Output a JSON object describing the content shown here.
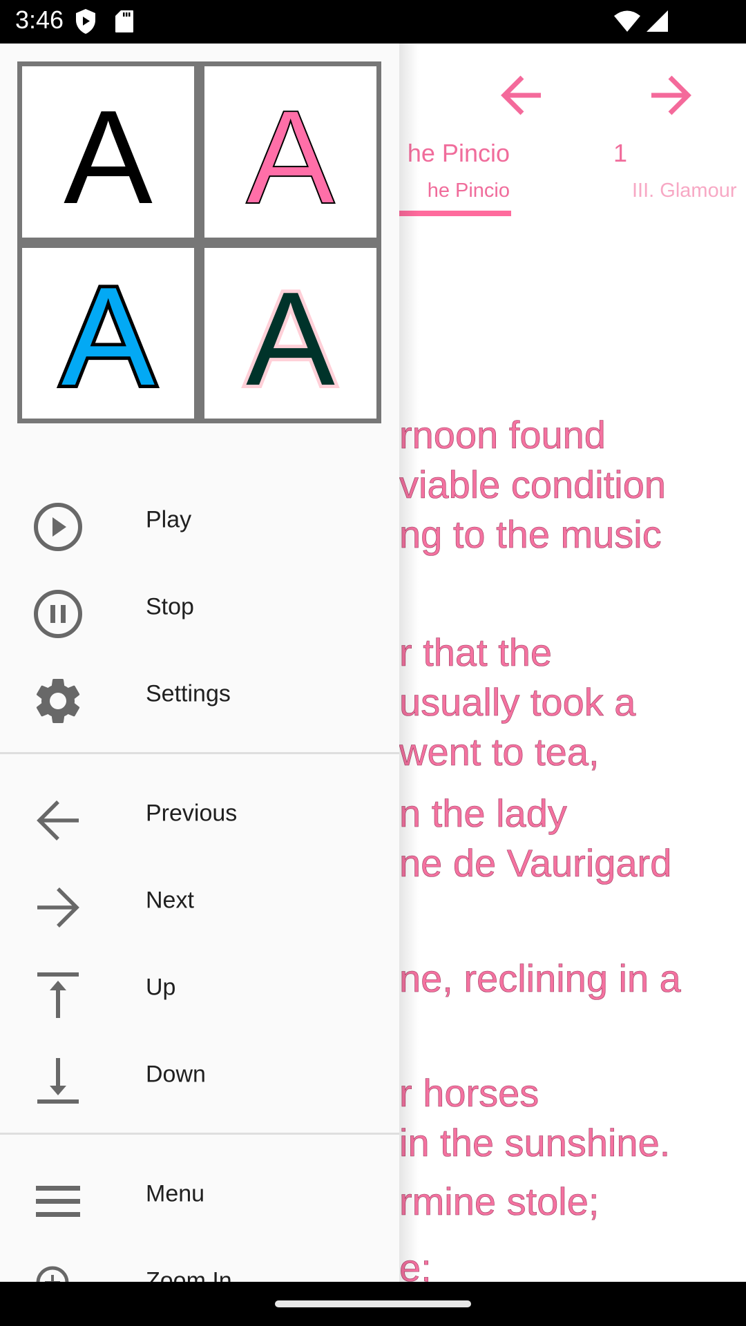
{
  "status_bar": {
    "time": "3:46",
    "icons": [
      "shield-play-icon",
      "sd-card-icon",
      "wifi-icon",
      "signal-icon"
    ]
  },
  "reader": {
    "nav": {
      "prev_icon": "arrow-left-icon",
      "next_icon": "arrow-right-icon"
    },
    "tabs": [
      {
        "title": "he Pincio",
        "subtitle": "he Pincio",
        "active": true
      },
      {
        "title": "1",
        "subtitle": "III. Glamour",
        "active": false
      }
    ],
    "paragraphs": [
      [
        "rnoon found",
        "viable condition",
        "ng to the music"
      ],
      [
        "r that the",
        "usually took a",
        " went to tea,"
      ],
      [
        "n the lady",
        "ne de Vaurigard"
      ],
      [
        "ne, reclining in a"
      ],
      [
        "r horses",
        "in the sunshine."
      ],
      [
        "rmine stole;"
      ],
      [
        "e;"
      ]
    ],
    "accent_color": "#ff6b9d",
    "text_color": "#f472a0"
  },
  "drawer": {
    "themes": [
      {
        "name": "black-on-white",
        "fill": "#000000",
        "stroke": "none"
      },
      {
        "name": "pink-outlined",
        "fill": "#ff6fa8",
        "stroke": "#000000"
      },
      {
        "name": "blue-black-outline",
        "fill": "#03a9f4",
        "stroke": "#000000"
      },
      {
        "name": "darkgreen-pink-halo",
        "fill": "#00332a",
        "stroke": "#ffd0d8"
      }
    ],
    "theme_letter": "A",
    "groups": [
      [
        {
          "label": "Play",
          "icon": "play-circle-icon"
        },
        {
          "label": "Stop",
          "icon": "pause-circle-icon"
        },
        {
          "label": "Settings",
          "icon": "gear-icon"
        }
      ],
      [
        {
          "label": "Previous",
          "icon": "arrow-left-icon"
        },
        {
          "label": "Next",
          "icon": "arrow-right-icon"
        },
        {
          "label": "Up",
          "icon": "arrow-up-to-bar-icon"
        },
        {
          "label": "Down",
          "icon": "arrow-down-to-bar-icon"
        }
      ],
      [
        {
          "label": "Menu",
          "icon": "hamburger-menu-icon"
        },
        {
          "label": "Zoom In",
          "icon": "zoom-in-icon"
        }
      ]
    ]
  }
}
